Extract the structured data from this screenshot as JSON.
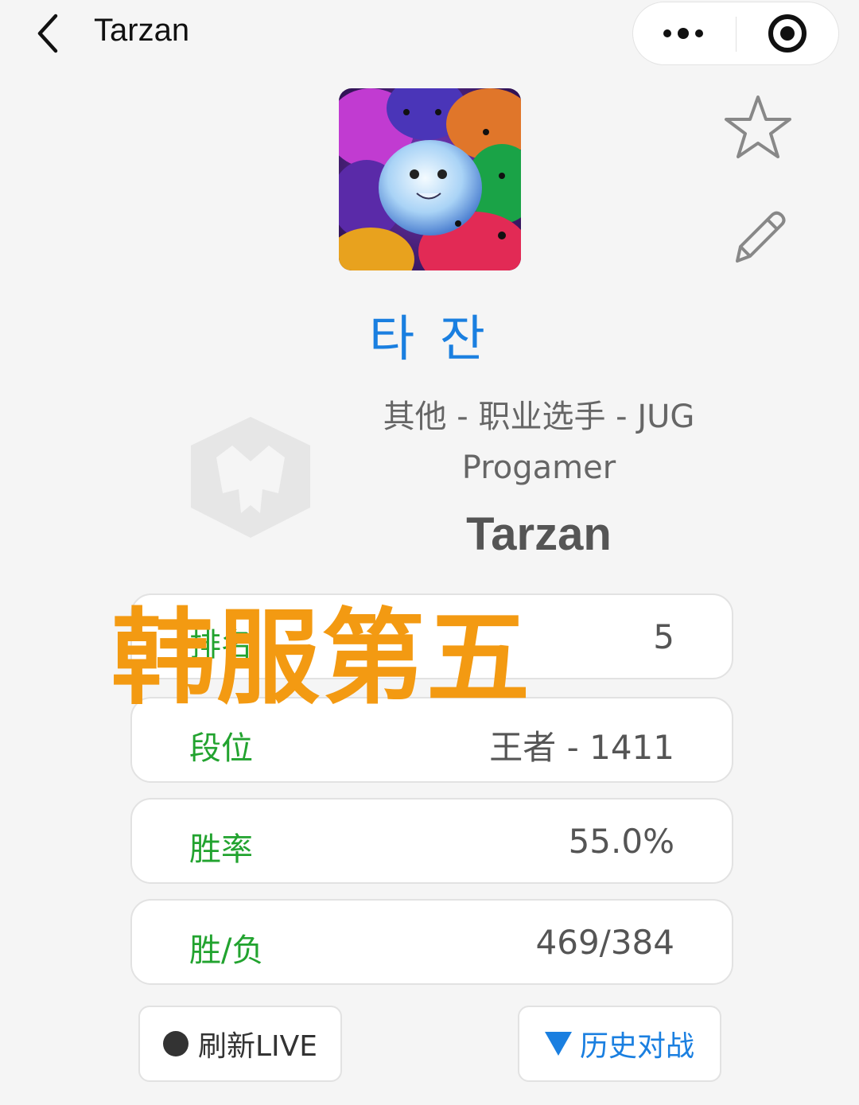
{
  "nav": {
    "title": "Tarzan",
    "back_icon": "chevron-left-icon",
    "more_icon": "more-dots-icon",
    "close_icon": "target-close-icon"
  },
  "profile": {
    "avatar_icon": "poro-avatar",
    "korean_name": "타 잔",
    "team_line": "其他 - 职业选手 - JUG",
    "role": "Progamer",
    "player_id": "Tarzan",
    "favorite_icon": "star-icon",
    "edit_icon": "pencil-icon"
  },
  "stats": [
    {
      "label": "排名",
      "value": "5"
    },
    {
      "label": "段位",
      "value": "王者 - 1411"
    },
    {
      "label": "胜率",
      "value": "55.0%"
    },
    {
      "label": "胜/负",
      "value": "469/384"
    }
  ],
  "overlay": {
    "text": "韩服第五",
    "color": "#f39a12"
  },
  "buttons": {
    "refresh_label": "刷新LIVE",
    "history_label": "历史对战"
  },
  "colors": {
    "accent_blue": "#1a7fe0",
    "label_green": "#22a32f"
  }
}
